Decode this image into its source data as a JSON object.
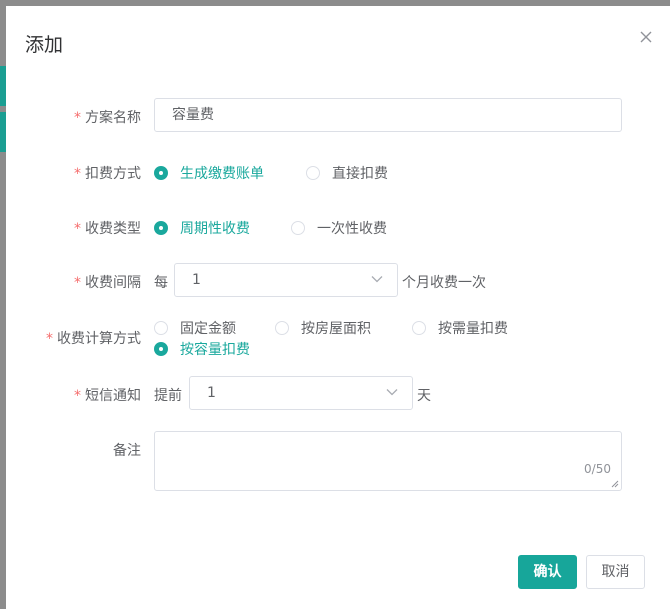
{
  "dialog": {
    "title": "添加"
  },
  "form": {
    "scheme_name": {
      "label": "方案名称",
      "value": "容量费"
    },
    "deduct_method": {
      "label": "扣费方式",
      "options": [
        {
          "label": "生成缴费账单",
          "checked": true
        },
        {
          "label": "直接扣费",
          "checked": false
        }
      ]
    },
    "charge_type": {
      "label": "收费类型",
      "options": [
        {
          "label": "周期性收费",
          "checked": true
        },
        {
          "label": "一次性收费",
          "checked": false
        }
      ]
    },
    "charge_interval": {
      "label": "收费间隔",
      "prefix": "每",
      "value": "1",
      "suffix": "个月收费一次"
    },
    "calc_method": {
      "label": "收费计算方式",
      "options": [
        {
          "label": "固定金额",
          "checked": false
        },
        {
          "label": "按房屋面积",
          "checked": false
        },
        {
          "label": "按需量扣费",
          "checked": false
        },
        {
          "label": "按容量扣费",
          "checked": true
        }
      ]
    },
    "sms_notice": {
      "label": "短信通知",
      "prefix": "提前",
      "value": "1",
      "suffix": "天"
    },
    "remark": {
      "label": "备注",
      "value": "",
      "counter": "0/50"
    }
  },
  "buttons": {
    "confirm": "确认",
    "cancel": "取消"
  },
  "colors": {
    "primary": "#17a69a",
    "required": "#f56c6c",
    "border": "#dcdfe6"
  }
}
